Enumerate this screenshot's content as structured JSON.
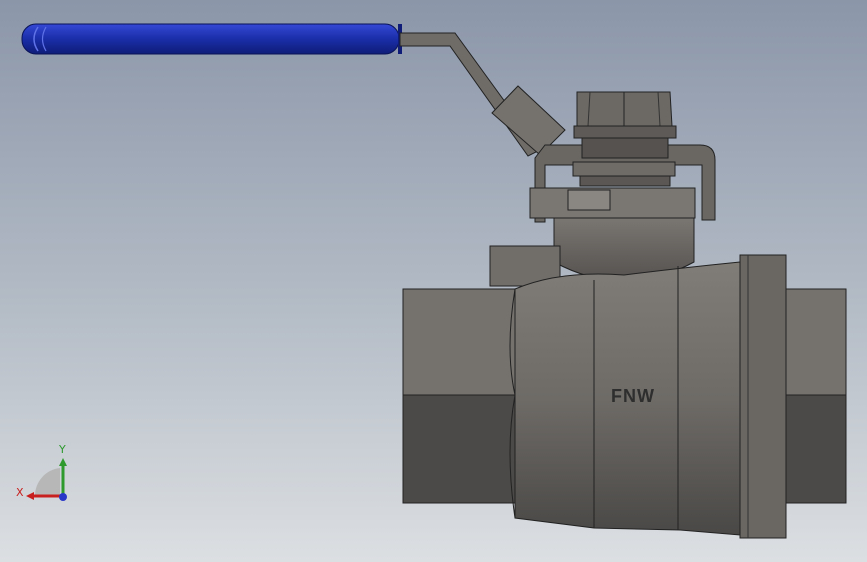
{
  "model": {
    "brand_marking": "FNW"
  },
  "triad": {
    "x_label": "X",
    "y_label": "Y"
  },
  "colors": {
    "handle_grip": "#1a2ea8",
    "body_light": "#7a7773",
    "body_dark": "#4a4846",
    "axis_x": "#c8201e",
    "axis_y": "#2e9a2e",
    "axis_z": "#2a38c8"
  }
}
